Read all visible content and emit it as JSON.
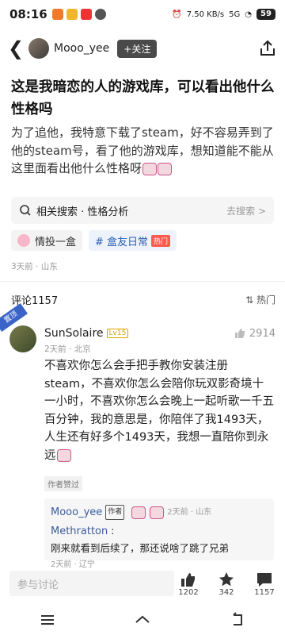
{
  "status": {
    "time": "08:16",
    "net": "7.50 KB/s",
    "signal": "5G",
    "battery": "59"
  },
  "header": {
    "username": "Mooo_yee",
    "follow_label": "+关注"
  },
  "post": {
    "title": "这是我暗恋的人的游戏库，可以看出他什么性格吗",
    "body": "为了追他，我特意下载了steam，好不容易弄到了他的steam号，看了他的游戏库，想知道能不能从这里面看出他什么性格呀",
    "search_label": "相关搜索 · 性格分析",
    "search_go": "去搜索 >",
    "tag1": "情投一盒",
    "tag2": "# 盒友日常",
    "tag2_badge": "热门",
    "meta": "3天前 · 山东"
  },
  "comments_head": {
    "count_label": "评论1157",
    "sort_label": "热门"
  },
  "top_comment": {
    "pin_label": "置顶",
    "name": "SunSolaire",
    "level": "Lv15",
    "likes": "2914",
    "meta": "2天前 · 北京",
    "text": "不喜欢你怎么会手把手教你安装注册steam，不喜欢你怎么会陪你玩双影奇境十一小时，不喜欢你怎么会晚上一起听歌一千五百分钟，我的意思是，你陪伴了我1493天，人生还有好多个1493天，我想一直陪你到永远",
    "author_badge": "作者赞过"
  },
  "replies": [
    {
      "name": "Mooo_yee",
      "badge": "作者",
      "text": "",
      "time": "2天前 · 山东"
    },
    {
      "name": "Methratton",
      "badge": "",
      "text": "刚来就看到后续了，那还说啥了跳了兄弟",
      "time": "2天前 · 辽宁"
    }
  ],
  "bottom": {
    "input_placeholder": "参与讨论",
    "likes": "1202",
    "stars": "342",
    "comments": "1157"
  }
}
